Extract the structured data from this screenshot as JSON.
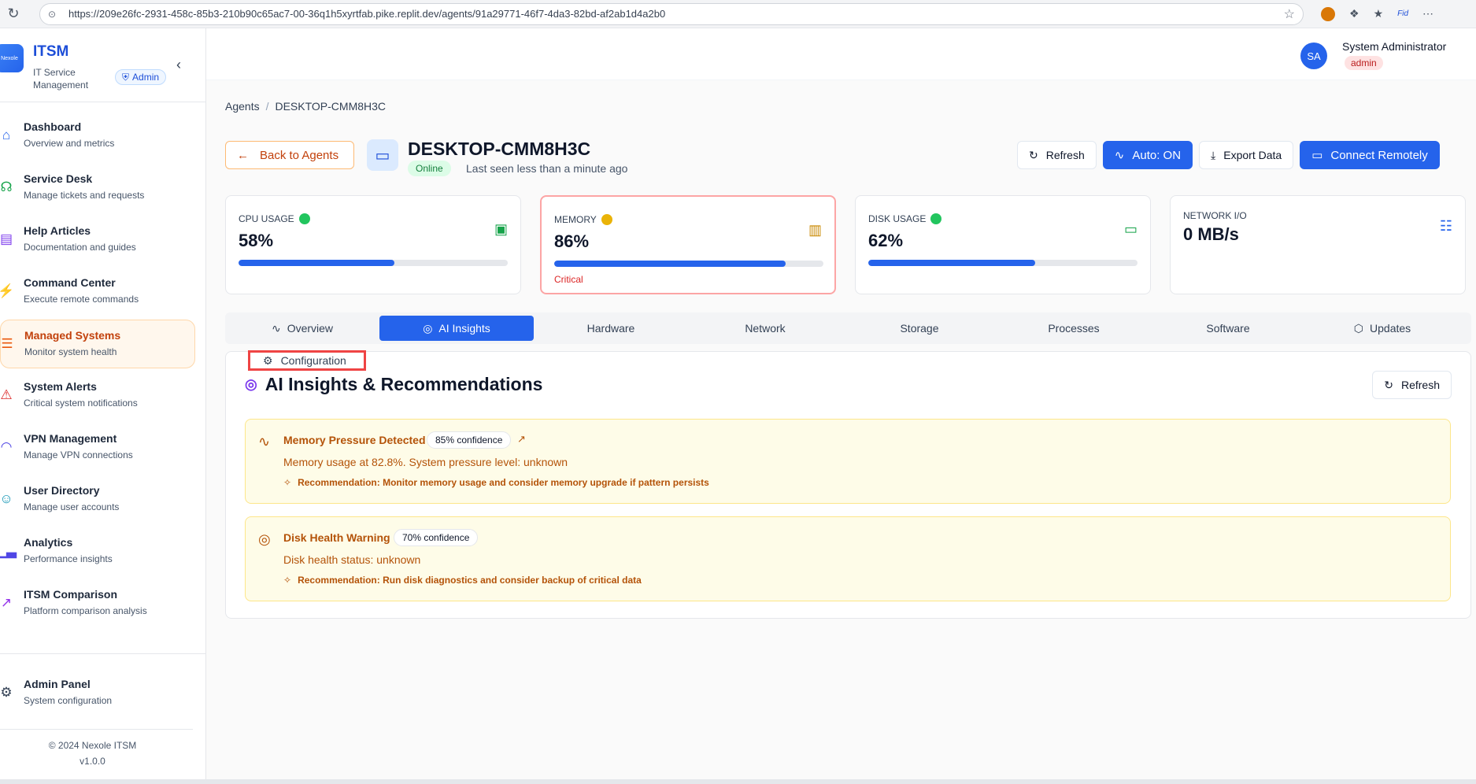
{
  "browser": {
    "url": "https://209e26fc-2931-458c-85b3-210b90c65ac7-00-36q1h5xyrtfab.pike.replit.dev/agents/91a29771-46f7-4da3-82bd-af2ab1d4a2b0"
  },
  "brand": {
    "logo_text": "Nexole",
    "title": "ITSM",
    "subtitle": "IT Service Management",
    "role_badge": "Admin"
  },
  "sidebar": {
    "items": [
      {
        "label": "Dashboard",
        "desc": "Overview and metrics",
        "icon": "home-icon",
        "color": "#2563eb"
      },
      {
        "label": "Service Desk",
        "desc": "Manage tickets and requests",
        "icon": "headset-icon",
        "color": "#16a34a"
      },
      {
        "label": "Help Articles",
        "desc": "Documentation and guides",
        "icon": "book-icon",
        "color": "#7c3aed"
      },
      {
        "label": "Command Center",
        "desc": "Execute remote commands",
        "icon": "bolt-icon",
        "color": "#ea580c"
      },
      {
        "label": "Managed Systems",
        "desc": "Monitor system health",
        "icon": "server-icon",
        "color": "#ea580c"
      },
      {
        "label": "System Alerts",
        "desc": "Critical system notifications",
        "icon": "alert-icon",
        "color": "#dc2626"
      },
      {
        "label": "VPN Management",
        "desc": "Manage VPN connections",
        "icon": "wifi-icon",
        "color": "#4f46e5"
      },
      {
        "label": "User Directory",
        "desc": "Manage user accounts",
        "icon": "users-icon",
        "color": "#0891b2"
      },
      {
        "label": "Analytics",
        "desc": "Performance insights",
        "icon": "chart-icon",
        "color": "#4f46e5"
      },
      {
        "label": "ITSM Comparison",
        "desc": "Platform comparison analysis",
        "icon": "trend-icon",
        "color": "#9333ea"
      }
    ],
    "admin": {
      "label": "Admin Panel",
      "desc": "System configuration"
    },
    "footer_copyright": "© 2024 Nexole ITSM",
    "footer_version": "v1.0.0"
  },
  "user": {
    "initials": "SA",
    "name": "System Administrator",
    "role": "admin"
  },
  "breadcrumb": {
    "parent": "Agents",
    "separator": "/",
    "current": "DESKTOP-CMM8H3C"
  },
  "header": {
    "back_label": "Back to Agents",
    "hostname": "DESKTOP-CMM8H3C",
    "status": "Online",
    "last_seen": "Last seen less than a minute ago"
  },
  "actions": {
    "refresh": "Refresh",
    "auto": "Auto: ON",
    "export": "Export Data",
    "connect": "Connect Remotely"
  },
  "metrics": [
    {
      "label": "CPU USAGE",
      "value": "58%",
      "percent": 58,
      "status_color": "#22c55e",
      "icon": "cpu-icon",
      "icon_color": "#16a34a",
      "note": ""
    },
    {
      "label": "MEMORY",
      "value": "86%",
      "percent": 86,
      "status_color": "#eab308",
      "icon": "memory-icon",
      "icon_color": "#ca8a04",
      "note": "Critical"
    },
    {
      "label": "DISK USAGE",
      "value": "62%",
      "percent": 62,
      "status_color": "#22c55e",
      "icon": "disk-icon",
      "icon_color": "#16a34a",
      "note": ""
    },
    {
      "label": "NETWORK I/O",
      "value": "0 MB/s",
      "icon": "network-icon",
      "icon_color": "#2563eb"
    }
  ],
  "tabs": [
    {
      "label": "Overview",
      "icon": "activity-icon"
    },
    {
      "label": "AI Insights",
      "icon": "brain-icon",
      "active": true
    },
    {
      "label": "Hardware"
    },
    {
      "label": "Network"
    },
    {
      "label": "Storage"
    },
    {
      "label": "Processes"
    },
    {
      "label": "Software"
    },
    {
      "label": "Updates",
      "icon": "package-icon"
    }
  ],
  "config_tab": "Configuration",
  "insights_panel": {
    "title": "AI Insights & Recommendations",
    "refresh": "Refresh",
    "items": [
      {
        "title": "Memory Pressure Detected",
        "confidence": "85% confidence",
        "icon": "activity-icon",
        "description": "Memory usage at 82.8%. System pressure level: unknown",
        "recommendation": "Recommendation: Monitor memory usage and consider memory upgrade if pattern persists"
      },
      {
        "title": "Disk Health Warning",
        "confidence": "70% confidence",
        "icon": "target-icon",
        "description": "Disk health status: unknown",
        "recommendation": "Recommendation: Run disk diagnostics and consider backup of critical data"
      }
    ]
  }
}
